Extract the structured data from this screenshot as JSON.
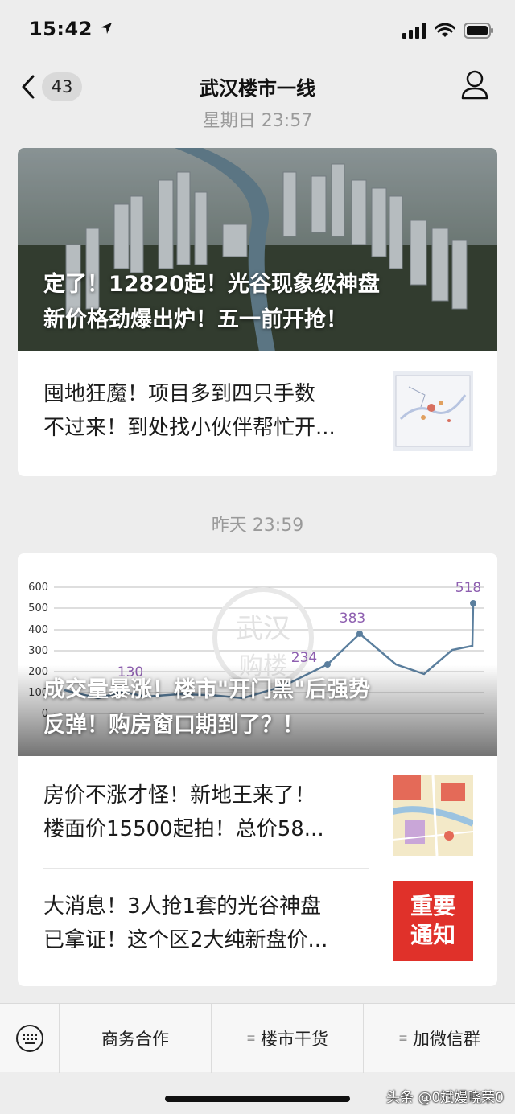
{
  "status": {
    "time": "15:42"
  },
  "nav": {
    "badge": "43",
    "title": "武汉楼市一线"
  },
  "groups": [
    {
      "timestamp": "星期日 23:57",
      "hero_title_line1": "定了！12820起！光谷现象级神盘",
      "hero_title_line2": "新价格劲爆出炉！五一前开抢！",
      "items": [
        {
          "line1": "囤地狂魔！项目多到四只手数",
          "line2": "不过来！到处找小伙伴帮忙开..."
        }
      ]
    },
    {
      "timestamp": "昨天 23:59",
      "hero_title_line1": "成交量暴涨！楼市\"开门黑\"后强势",
      "hero_title_line2": "反弹！购房窗口期到了？！",
      "chart": {
        "y_ticks": [
          "600",
          "500",
          "400",
          "300",
          "200",
          "100",
          "0"
        ],
        "labels": [
          "130",
          "234",
          "383",
          "518"
        ],
        "watermark_line1": "武汉",
        "watermark_line2": "购楼"
      },
      "items": [
        {
          "line1": "房价不涨才怪！新地王来了！",
          "line2": "楼面价15500起拍！总价58..."
        },
        {
          "line1": "大消息！3人抢1套的光谷神盘",
          "line2": "已拿证！这个区2大纯新盘价...",
          "thumb_line1": "重要",
          "thumb_line2": "通知"
        }
      ]
    }
  ],
  "bottom_menu": [
    {
      "label": "商务合作"
    },
    {
      "label": "楼市干货"
    },
    {
      "label": "加微信群"
    }
  ],
  "watermark": "头条 @0斌嫚晓荣0",
  "colors": {
    "notice_red": "#e0312a",
    "chart_line": "#5b7f9e",
    "chart_label": "#8e5fb0"
  }
}
